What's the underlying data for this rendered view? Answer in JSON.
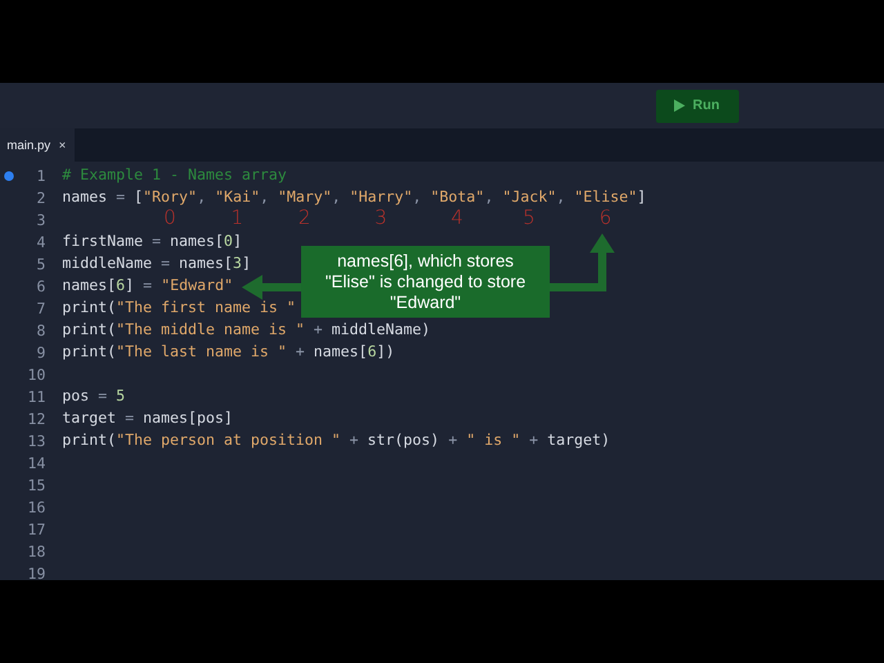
{
  "toolbar": {
    "run_button": "Run"
  },
  "tabs": [
    {
      "label": "main.py",
      "close": "×",
      "selected": true
    }
  ],
  "editor": {
    "lines": [
      {
        "number": "1",
        "breakpoint": true,
        "tokens": [
          {
            "kind": "comment",
            "text": "# Example 1 - Names array"
          }
        ]
      },
      {
        "number": "2",
        "breakpoint": false,
        "tokens": [
          {
            "kind": "plain",
            "text": "names"
          },
          {
            "kind": "op",
            "text": " = "
          },
          {
            "kind": "plain",
            "text": "["
          },
          {
            "kind": "string",
            "text": "\"Rory\""
          },
          {
            "kind": "op",
            "text": ", "
          },
          {
            "kind": "string",
            "text": "\"Kai\""
          },
          {
            "kind": "op",
            "text": ", "
          },
          {
            "kind": "string",
            "text": "\"Mary\""
          },
          {
            "kind": "op",
            "text": ", "
          },
          {
            "kind": "string",
            "text": "\"Harry\""
          },
          {
            "kind": "op",
            "text": ", "
          },
          {
            "kind": "string",
            "text": "\"Bota\""
          },
          {
            "kind": "op",
            "text": ", "
          },
          {
            "kind": "string",
            "text": "\"Jack\""
          },
          {
            "kind": "op",
            "text": ", "
          },
          {
            "kind": "string",
            "text": "\"Elise\""
          },
          {
            "kind": "plain",
            "text": "]"
          }
        ]
      },
      {
        "number": "3",
        "breakpoint": false,
        "indices": [
          "0",
          "1",
          "2",
          "3",
          "4",
          "5",
          "6"
        ]
      },
      {
        "number": "4",
        "breakpoint": false,
        "tokens": [
          {
            "kind": "plain",
            "text": "firstName"
          },
          {
            "kind": "op",
            "text": " = "
          },
          {
            "kind": "plain",
            "text": "names["
          },
          {
            "kind": "number",
            "text": "0"
          },
          {
            "kind": "plain",
            "text": "]"
          }
        ]
      },
      {
        "number": "5",
        "breakpoint": false,
        "tokens": [
          {
            "kind": "plain",
            "text": "middleName"
          },
          {
            "kind": "op",
            "text": " = "
          },
          {
            "kind": "plain",
            "text": "names["
          },
          {
            "kind": "number",
            "text": "3"
          },
          {
            "kind": "plain",
            "text": "]"
          }
        ]
      },
      {
        "number": "6",
        "breakpoint": false,
        "tokens": [
          {
            "kind": "plain",
            "text": "names["
          },
          {
            "kind": "number",
            "text": "6"
          },
          {
            "kind": "plain",
            "text": "]"
          },
          {
            "kind": "op",
            "text": " = "
          },
          {
            "kind": "string",
            "text": "\"Edward\""
          }
        ]
      },
      {
        "number": "7",
        "breakpoint": false,
        "tokens": [
          {
            "kind": "plain",
            "text": "print("
          },
          {
            "kind": "string",
            "text": "\"The first name is \""
          }
        ]
      },
      {
        "number": "8",
        "breakpoint": false,
        "tokens": [
          {
            "kind": "plain",
            "text": "print("
          },
          {
            "kind": "string",
            "text": "\"The middle name is \""
          },
          {
            "kind": "op",
            "text": " + "
          },
          {
            "kind": "plain",
            "text": "middleName)"
          }
        ]
      },
      {
        "number": "9",
        "breakpoint": false,
        "tokens": [
          {
            "kind": "plain",
            "text": "print("
          },
          {
            "kind": "string",
            "text": "\"The last name is \""
          },
          {
            "kind": "op",
            "text": " + "
          },
          {
            "kind": "plain",
            "text": "names["
          },
          {
            "kind": "number",
            "text": "6"
          },
          {
            "kind": "plain",
            "text": "])"
          }
        ]
      },
      {
        "number": "10",
        "breakpoint": false
      },
      {
        "number": "11",
        "breakpoint": false,
        "tokens": [
          {
            "kind": "plain",
            "text": "pos"
          },
          {
            "kind": "op",
            "text": " = "
          },
          {
            "kind": "number",
            "text": "5"
          }
        ]
      },
      {
        "number": "12",
        "breakpoint": false,
        "tokens": [
          {
            "kind": "plain",
            "text": "target"
          },
          {
            "kind": "op",
            "text": " = "
          },
          {
            "kind": "plain",
            "text": "names[pos]"
          }
        ]
      },
      {
        "number": "13",
        "breakpoint": false,
        "tokens": [
          {
            "kind": "plain",
            "text": "print("
          },
          {
            "kind": "string",
            "text": "\"The person at position \""
          },
          {
            "kind": "op",
            "text": " + "
          },
          {
            "kind": "plain",
            "text": "str(pos)"
          },
          {
            "kind": "op",
            "text": " + "
          },
          {
            "kind": "string",
            "text": "\" is \""
          },
          {
            "kind": "op",
            "text": " + "
          },
          {
            "kind": "plain",
            "text": "target)"
          }
        ]
      },
      {
        "number": "14",
        "breakpoint": false
      },
      {
        "number": "15",
        "breakpoint": false
      },
      {
        "number": "16",
        "breakpoint": false
      },
      {
        "number": "17",
        "breakpoint": false
      },
      {
        "number": "18",
        "breakpoint": false
      },
      {
        "number": "19",
        "breakpoint": false
      }
    ]
  },
  "callout": {
    "text": "names[6], which stores \"Elise\" is changed to store \"Edward\""
  }
}
